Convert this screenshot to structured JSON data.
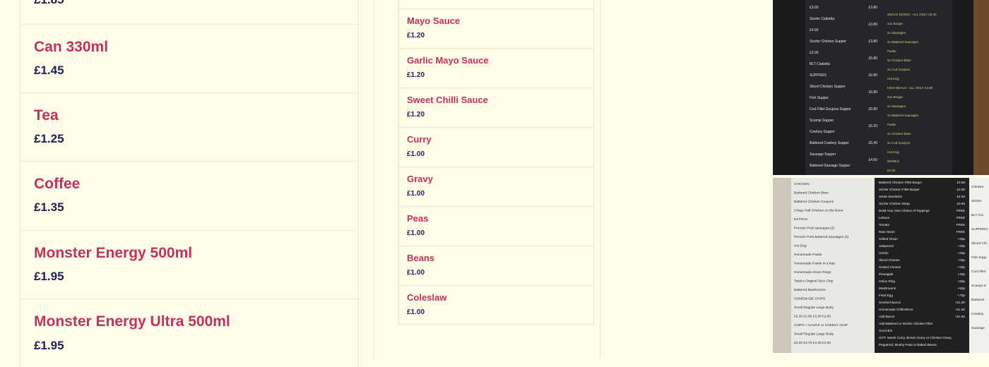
{
  "drinks": {
    "items": [
      {
        "name": "",
        "price": "£1.85"
      },
      {
        "name": "Can 330ml",
        "price": "£1.45"
      },
      {
        "name": "Tea",
        "price": "£1.25"
      },
      {
        "name": "Coffee",
        "price": "£1.35"
      },
      {
        "name": "Monster Energy 500ml",
        "price": "£1.95"
      },
      {
        "name": "Monster Energy Ultra 500ml",
        "price": "£1.95"
      }
    ]
  },
  "sauces": {
    "items": [
      {
        "name": "Mayo Sauce",
        "price": "£1.20"
      },
      {
        "name": "Garlic Mayo Sauce",
        "price": "£1.20"
      },
      {
        "name": "Sweet Chilli Sauce",
        "price": "£1.20"
      },
      {
        "name": "Curry",
        "price": "£1.00"
      },
      {
        "name": "Gravy",
        "price": "£1.00"
      },
      {
        "name": "Peas",
        "price": "£1.00"
      },
      {
        "name": "Beans",
        "price": "£1.00"
      },
      {
        "name": "Coleslaw",
        "price": "£1.00"
      }
    ]
  },
  "photos": {
    "top": {
      "columns": [
        {
          "lines": [
            "£3.60",
            "Sizzler Ciabatta",
            "£4.60",
            "Sizzler Chicken Supper",
            "£3.90",
            "BLT Ciabatta",
            "SUPPERS",
            "Sliced Chicken Supper",
            "Fish Supper",
            "Cod Fillet Goujons Supper",
            "Scampi Supper",
            "Cowboy Supper",
            "Battered Cowboy Supper",
            "Sausage Supper",
            "Battered Sausage Supper"
          ]
        },
        {
          "lines": [
            "£3.80",
            "£3.80",
            "£3.80",
            "£5.80",
            "£6.80",
            "£6.80",
            "£6.80",
            "£5.20",
            "£5.40",
            "£4.60"
          ]
        },
        {
          "lines": [
            "SNACK BOXES - ALL ONLY £6.30",
            "2oz Burger",
            "2x Sausages",
            "2x Battered Sausages",
            "Pastie",
            "6x Chicken Bites",
            "2x Cod Goujons",
            "Hot Dog",
            "KIDS MEALS - ALL ONLY £3.80",
            "2oz Burger",
            "2x Sausages",
            "2x Battered Sausages",
            "Pastie",
            "4x Chicken Bites",
            "2x Cod Goujons",
            "Hot Dog",
            "DRINKS",
            "£0.90"
          ]
        }
      ]
    },
    "bottom": {
      "columns": [
        {
          "lines": [
            "CHICKEN",
            "Battered Chicken Bites",
            "Battered Chicken Goujons",
            "Crispy Half Chicken on the Bone",
            "EXTRAS",
            "Premier Pork sausages (2)",
            "Premier Pork Battered Sausages (2)",
            "Hot Dog",
            "Homemade Pastie",
            "Homemade Pastie in a bap",
            "Homemade Onion Rings",
            "Taste's Original Taco Chip",
            "Battered Mushrooms",
            "HOMEMADE CHIPS",
            "Small Regular Large Butty",
            "£2.30 £2.80 £3.30 £2.80",
            "CHIPS + SAUCE or CHEESY CHIP",
            "Small Regular Large Butty",
            "£3.00 £3.70 £4.40 £3.50"
          ]
        },
        {
          "lines": [
            "Battered Chicken Fillet Burger",
            "Sizzler Chicken Fillet Burger",
            "Steak Sandwich",
            "Sizzler Chicken Wrap",
            "Build Your Own Choice of Toppings",
            "Lettuce",
            "Tomato",
            "Raw Onion",
            "Grilled Onion",
            "Jalapenos",
            "Gerkin",
            "Sliced Cheese",
            "Grated Cheese",
            "Pineapple",
            "Onion Ring",
            "Mushrooms",
            "Fried Egg",
            "Smoked Bacon",
            "Homemade Chilli Mince",
            "Add Bacon",
            "Add Battered or Sizzler Chicken Fillet",
            "SAUCES",
            "HOT: Sweet Curry, Brown Gravy or Chicken Gravy,",
            "Peppered, Mushy Peas or Baked Beans."
          ]
        },
        {
          "lines": [
            "£3.80",
            "£3.80",
            "£4.60",
            "£3.90",
            "FREE",
            "FREE",
            "FREE",
            "FREE",
            "+20p",
            "+20p",
            "+20p",
            "+40p",
            "+40p",
            "+40p",
            "+50p",
            "+50p",
            "+70p",
            "+£1.00",
            "+£1.50",
            "+£1.50"
          ]
        },
        {
          "lines": [
            "Chicken",
            "Sizzler",
            "BLT Cia",
            "SUPPERS",
            "Sliced Chi",
            "Fish Supp",
            "Cod Fillet",
            "Scampi S",
            "Battered",
            "Cowboy",
            "Sausage"
          ]
        }
      ]
    }
  }
}
